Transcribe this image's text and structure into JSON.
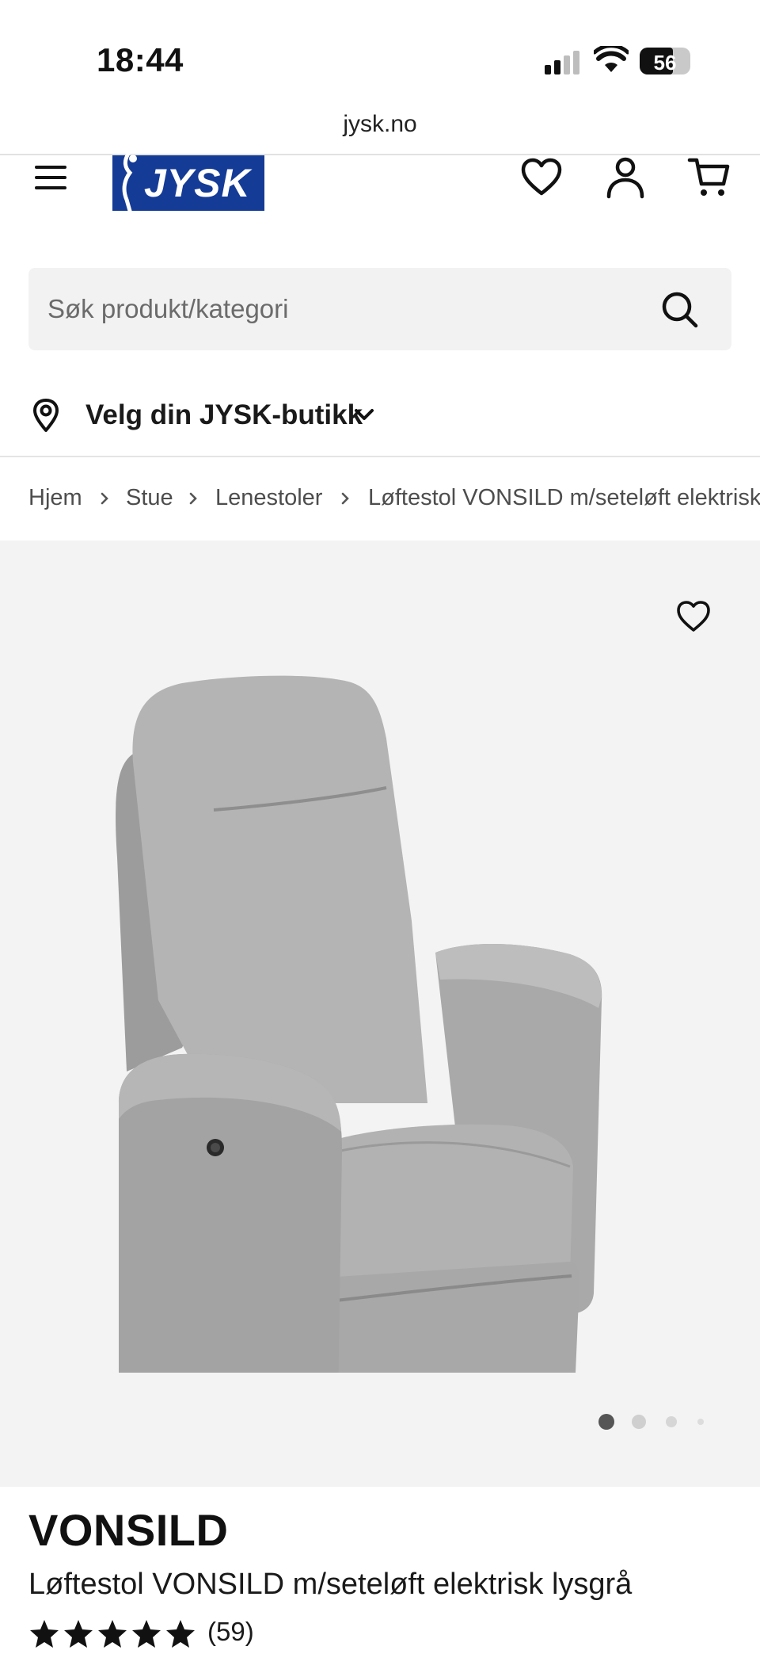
{
  "status_bar": {
    "time": "18:44",
    "battery": "56",
    "signal_icon": "cellular-signal-icon",
    "wifi_icon": "wifi-icon"
  },
  "browser": {
    "url": "jysk.no"
  },
  "header": {
    "logo_text": "JYSK",
    "brand_color": "#143b96",
    "icons": [
      "menu-icon",
      "heart-icon",
      "user-icon",
      "cart-icon"
    ]
  },
  "search": {
    "placeholder": "Søk produkt/kategori",
    "icon": "search-icon"
  },
  "store_picker": {
    "label": "Velg din JYSK-butikk",
    "icon": "location-pin-icon"
  },
  "breadcrumb": {
    "items": [
      "Hjem",
      "Stue",
      "Lenestoler",
      "Løftestol VONSILD m/seteløft elektrisk lysgrå"
    ]
  },
  "gallery": {
    "background": "#f3f3f3",
    "image_count": 4,
    "active_index": 0
  },
  "product": {
    "brand": "VONSILD",
    "title": "Løftestol VONSILD m/seteløft elektrisk lysgrå",
    "rating": 5,
    "review_count": "(59)"
  }
}
